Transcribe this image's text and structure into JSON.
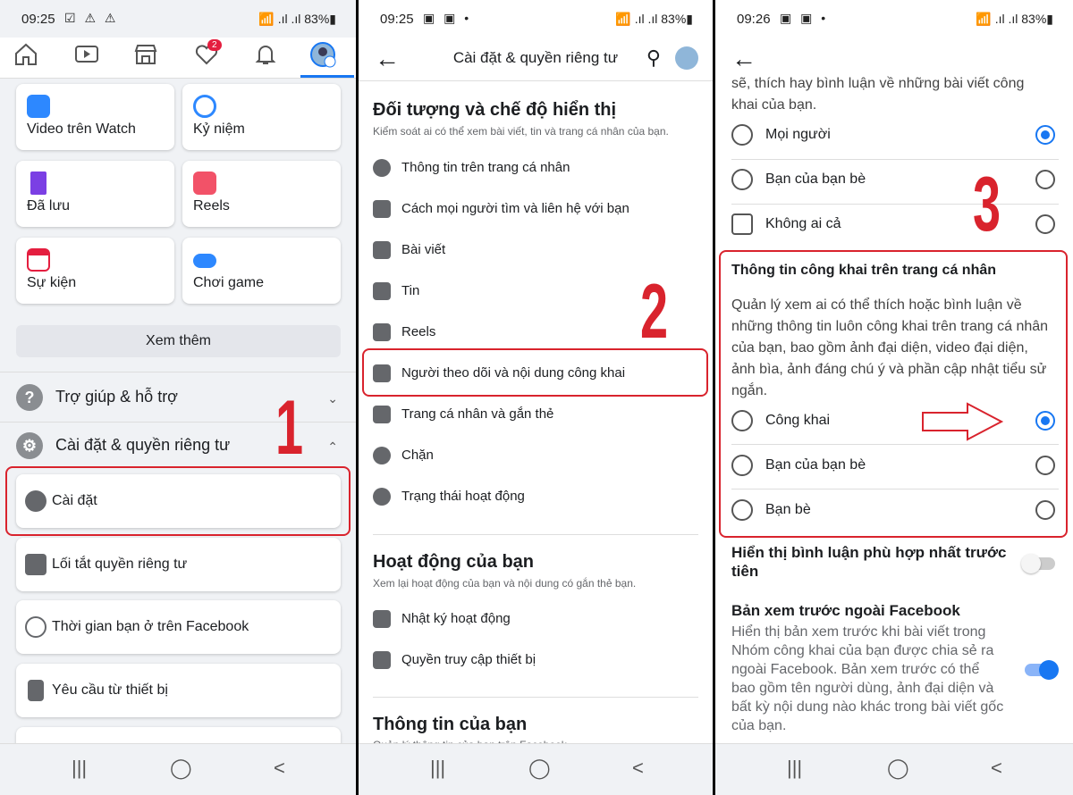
{
  "p1": {
    "status": {
      "time": "09:25",
      "icons": "☑ ⚠ ⚠",
      "right": "📶 .ıl .ıl 83%▮"
    },
    "tabs": {
      "badge": "2"
    },
    "cards": [
      {
        "label": "Video trên Watch"
      },
      {
        "label": "Kỷ niệm"
      },
      {
        "label": "Đã lưu"
      },
      {
        "label": "Reels"
      },
      {
        "label": "Sự kiện"
      },
      {
        "label": "Chơi game"
      }
    ],
    "more": "Xem thêm",
    "help": "Trợ giúp & hỗ trợ",
    "settings": "Cài đặt & quyền riêng tư",
    "help_icon": "?",
    "items": [
      {
        "label": "Cài đặt"
      },
      {
        "label": "Lối tắt quyền riêng tư"
      },
      {
        "label": "Thời gian bạn ở trên Facebook"
      },
      {
        "label": "Yêu cầu từ thiết bị"
      }
    ],
    "num": "1",
    "nav": {
      "recent": "|||",
      "home": "◯",
      "back": "<"
    }
  },
  "p2": {
    "status": {
      "time": "09:25",
      "icons": "▣ ▣ •",
      "right": "📶 .ıl .ıl 83%▮"
    },
    "back": "←",
    "title": "Cài đặt & quyền riêng tư",
    "s1": {
      "title": "Đối tượng và chế độ hiển thị",
      "sub": "Kiểm soát ai có thể xem bài viết, tin và trang cá nhân của bạn."
    },
    "rows": [
      "Thông tin trên trang cá nhân",
      "Cách mọi người tìm và liên hệ với bạn",
      "Bài viết",
      "Tin",
      "Reels",
      "Người theo dõi và nội dung công khai",
      "Trang cá nhân và gắn thẻ",
      "Chặn",
      "Trạng thái hoạt động"
    ],
    "s2": {
      "title": "Hoạt động của bạn",
      "sub": "Xem lại hoạt động của bạn và nội dung có gắn thẻ bạn."
    },
    "rows2": [
      "Nhật ký hoạt động",
      "Quyền truy cập thiết bị"
    ],
    "s3": {
      "title": "Thông tin của bạn",
      "sub": "Quản lý thông tin của bạn trên Facebook"
    },
    "num": "2",
    "nav": {
      "recent": "|||",
      "home": "◯",
      "back": "<"
    }
  },
  "p3": {
    "status": {
      "time": "09:26",
      "icons": "▣ ▣ •",
      "right": "📶 .ıl .ıl 83%▮"
    },
    "back": "←",
    "top_text": "sẽ, thích hay bình luận về những bài viết công khai của bạn.",
    "opts1": [
      {
        "label": "Mọi người",
        "on": true
      },
      {
        "label": "Bạn của bạn bè",
        "on": false
      },
      {
        "label": "Không ai cả",
        "on": false
      }
    ],
    "box_title": "Thông tin công khai trên trang cá nhân",
    "box_text": "Quản lý xem ai có thể thích hoặc bình luận về những thông tin luôn công khai trên trang cá nhân của bạn, bao gồm ảnh đại diện, video đại diện, ảnh bìa, ảnh đáng chú ý và phần cập nhật tiểu sử ngắn.",
    "opts2": [
      {
        "label": "Công khai",
        "on": true
      },
      {
        "label": "Bạn của bạn bè",
        "on": false
      },
      {
        "label": "Bạn bè",
        "on": false
      }
    ],
    "t1": "Hiển thị bình luận phù hợp nhất trước tiên",
    "t2_title": "Bản xem trước ngoài Facebook",
    "t2_text": "Hiển thị bản xem trước khi bài viết trong Nhóm công khai của bạn được chia sẻ ra ngoài Facebook. Bản xem trước có thể bao gồm tên người dùng, ảnh đại diện và bất kỳ nội dung nào khác trong bài viết gốc của bạn.",
    "toggle1": false,
    "toggle2": true,
    "num": "3",
    "nav": {
      "recent": "|||",
      "home": "◯",
      "back": "<"
    }
  }
}
